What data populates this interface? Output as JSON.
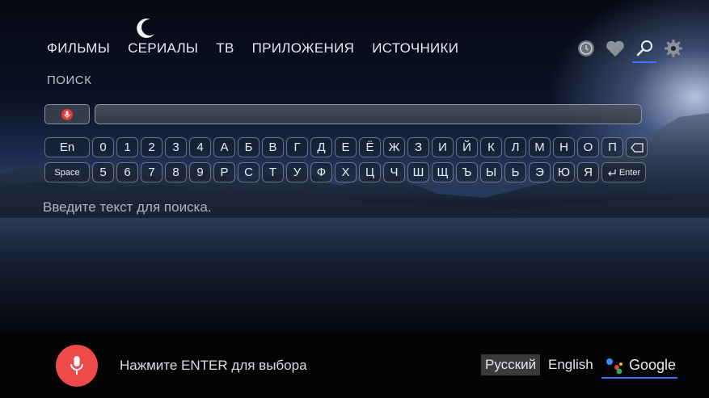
{
  "nav": {
    "items": [
      "ФИЛЬМЫ",
      "СЕРИАЛЫ",
      "ТВ",
      "ПРИЛОЖЕНИЯ",
      "ИСТОЧНИКИ"
    ]
  },
  "section_title": "ПОИСК",
  "search": {
    "value": "",
    "placeholder": ""
  },
  "keyboard": {
    "row1": [
      "En",
      "0",
      "1",
      "2",
      "3",
      "4",
      "А",
      "Б",
      "В",
      "Г",
      "Д",
      "Е",
      "Ё",
      "Ж",
      "З",
      "И",
      "Й",
      "К",
      "Л",
      "М",
      "Н",
      "О",
      "П"
    ],
    "row2": [
      "Space",
      "5",
      "6",
      "7",
      "8",
      "9",
      "Р",
      "С",
      "Т",
      "У",
      "Ф",
      "Х",
      "Ц",
      "Ч",
      "Ш",
      "Щ",
      "Ъ",
      "Ы",
      "Ь",
      "Э",
      "Ю",
      "Я"
    ],
    "enter_label": "Enter"
  },
  "hint": "Введите текст для поиска.",
  "footer": {
    "enter_hint": "Нажмите ENTER для выбора",
    "languages": [
      "Русский",
      "English"
    ],
    "selected_language": "Русский",
    "google_label": "Google"
  },
  "colors": {
    "accent": "#3b73ff",
    "mic": "#ef4a4a"
  }
}
